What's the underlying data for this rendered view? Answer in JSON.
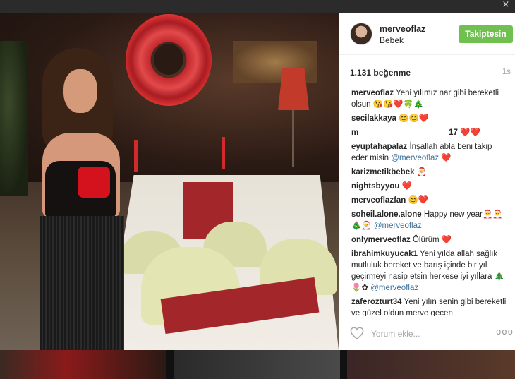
{
  "post": {
    "username": "merveoflaz",
    "location": "Bebek",
    "follow_label": "Takiptesin",
    "likes": "1.131 beğenme",
    "time": "1s"
  },
  "comments": [
    {
      "user": "merveoflaz",
      "text": "Yeni yılımız nar gibi bereketli olsun 😘😘❤️🍀🎄",
      "mention": ""
    },
    {
      "user": "secilakkaya",
      "text": "😊😊❤️",
      "mention": ""
    },
    {
      "user": "m____________________17",
      "text": "❤️❤️",
      "mention": ""
    },
    {
      "user": "eyuptahapalaz",
      "text": "İnşallah abla beni takip eder misin",
      "mention": "@merveoflaz ❤️"
    },
    {
      "user": "karizmetikbebek",
      "text": "🎅",
      "mention": ""
    },
    {
      "user": "nightsbyyou",
      "text": "❤️",
      "mention": ""
    },
    {
      "user": "merveoflazfan",
      "text": "😊❤️",
      "mention": ""
    },
    {
      "user": "soheil.alone.alone",
      "text": "Happy new year🎅🎅 🎄🎅",
      "mention": "@merveoflaz"
    },
    {
      "user": "onlymerveoflaz",
      "text": "Ölürüm ❤️",
      "mention": ""
    },
    {
      "user": "ibrahimkuyucak1",
      "text": "Yeni yılda allah sağlık mutluluk bereket ve barış içinde bir yıl geçirmeyi nasip etsin herkese iyi yıllara 🎄🌷✿",
      "mention": "@merveoflaz"
    },
    {
      "user": "zaferozturt34",
      "text": "Yeni yılın senin gibi bereketli ve güzel oldun merve gecen",
      "mention": ""
    }
  ],
  "footer": {
    "comment_placeholder": "Yorum ekle...",
    "more_label": "ooo"
  },
  "icons": {
    "like": "heart-icon",
    "more": "more-icon",
    "close": "close-icon"
  },
  "colors": {
    "follow_button": "#70c050",
    "mention": "#3f729b",
    "muted": "#a5a7aa"
  }
}
